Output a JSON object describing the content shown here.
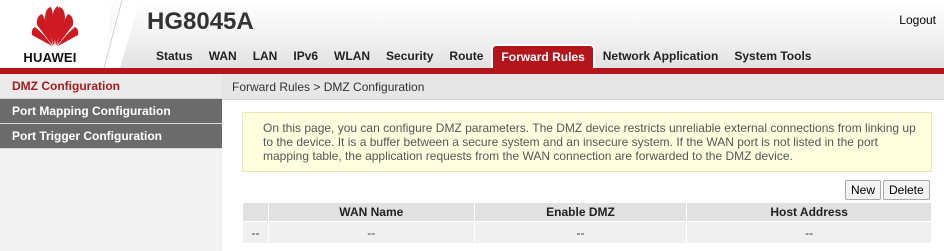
{
  "brand": {
    "logo_text": "HUAWEI",
    "model": "HG8045A",
    "accent": "#b3151b"
  },
  "header": {
    "logout_label": "Logout"
  },
  "nav": {
    "items": [
      {
        "label": "Status"
      },
      {
        "label": "WAN"
      },
      {
        "label": "LAN"
      },
      {
        "label": "IPv6"
      },
      {
        "label": "WLAN"
      },
      {
        "label": "Security"
      },
      {
        "label": "Route"
      },
      {
        "label": "Forward Rules",
        "active": true
      },
      {
        "label": "Network Application"
      },
      {
        "label": "System Tools"
      }
    ]
  },
  "sidebar": {
    "items": [
      {
        "label": "DMZ Configuration",
        "active": true
      },
      {
        "label": "Port Mapping Configuration"
      },
      {
        "label": "Port Trigger Configuration"
      }
    ]
  },
  "breadcrumb": "Forward Rules > DMZ Configuration",
  "info_text": "On this page, you can configure DMZ parameters. The DMZ device restricts unreliable external connections from linking up to the device. It is a buffer between a secure system and an insecure system. If the WAN port is not listed in the port mapping table, the application requests from the WAN connection are forwarded to the DMZ device.",
  "actions": {
    "new_label": "New",
    "delete_label": "Delete"
  },
  "table": {
    "headers": [
      "",
      "WAN Name",
      "Enable DMZ",
      "Host Address"
    ],
    "rows": [
      [
        "--",
        "--",
        "--",
        "--"
      ]
    ]
  }
}
